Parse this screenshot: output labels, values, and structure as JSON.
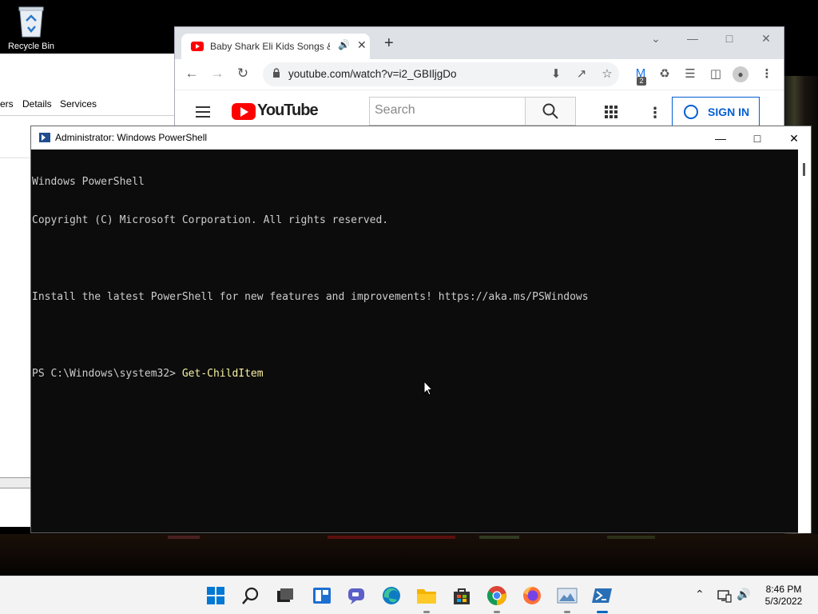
{
  "desktop": {
    "recycle_bin_label": "Recycle Bin"
  },
  "task_manager": {
    "tabs": [
      "ers",
      "Details",
      "Services"
    ]
  },
  "browser": {
    "tab_title": "Baby Shark Eli Kids Songs &",
    "url": "youtube.com/watch?v=i2_GBIljgDo",
    "extension_badge": "2",
    "youtube": {
      "logo_text": "YouTube",
      "search_placeholder": "Search",
      "sign_in_label": "SIGN IN"
    }
  },
  "powershell": {
    "window_title": "Administrator: Windows PowerShell",
    "lines": [
      "Windows PowerShell",
      "Copyright (C) Microsoft Corporation. All rights reserved.",
      "",
      "Install the latest PowerShell for new features and improvements! https://aka.ms/PSWindows",
      "",
      ""
    ],
    "prompt": "PS C:\\Windows\\system32> ",
    "command": "Get-ChildItem"
  },
  "taskbar": {
    "apps": [
      "windows-start",
      "search",
      "task-view",
      "widgets",
      "chat",
      "edge",
      "file-explorer",
      "store",
      "chrome",
      "firefox",
      "photos",
      "powershell"
    ],
    "clock_time": "8:46 PM",
    "clock_date": "5/3/2022"
  },
  "colors": {
    "console_bg": "#0c0c0c",
    "console_text": "#cccccc",
    "console_command": "#f9f1a5",
    "youtube_red": "#ff0000",
    "sign_in_blue": "#065fd4",
    "taskbar_bg": "#f3f3f3"
  }
}
